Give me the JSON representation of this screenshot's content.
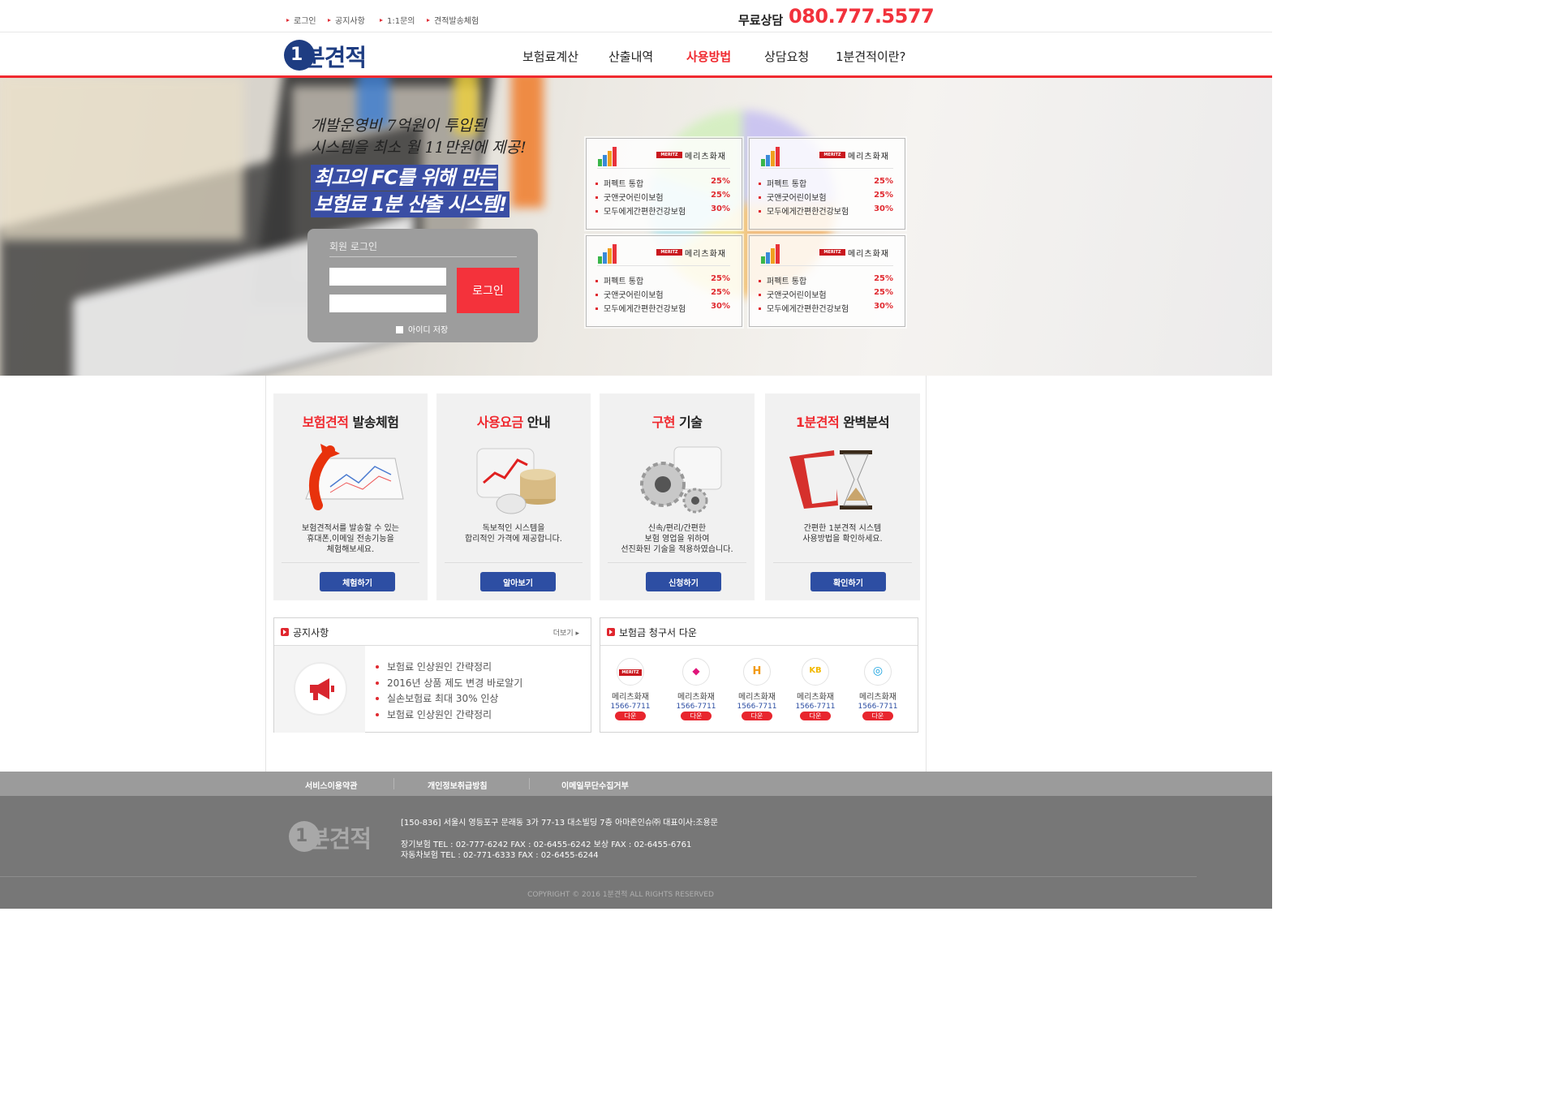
{
  "utility_nav": [
    "로그인",
    "공지사항",
    "1:1문의",
    "견적발송체험"
  ],
  "consult": {
    "label": "무료상담",
    "number": "080.777.5577"
  },
  "logo": {
    "one": "1",
    "rest": "분견적"
  },
  "gnb": [
    {
      "label": "보험료계산",
      "active": false
    },
    {
      "label": "산출내역",
      "active": false
    },
    {
      "label": "사용방법",
      "active": true
    },
    {
      "label": "상담요청",
      "active": false
    },
    {
      "label": "1분견적이란?",
      "active": false
    }
  ],
  "hero": {
    "copy_line1": "개발운영비 7억원이 투입된",
    "copy_line2": "시스템을 최소 월 11만원에 제공!",
    "highlight1": "최고의 FC를 위해 만든",
    "highlight2": "보험료 1분 산출 시스템!"
  },
  "login": {
    "title": "회원 로그인",
    "button": "로그인",
    "save_id": "아이디 저장"
  },
  "rate_cards": [
    {
      "brand_logo": "MERITZ",
      "company": "메리츠화재",
      "rows": [
        {
          "name": "퍼펙트 통합",
          "rate": "25%"
        },
        {
          "name": "굿앤굿어린이보험",
          "rate": "25%"
        },
        {
          "name": "모두에게간편한건강보험",
          "rate": "30%"
        }
      ]
    },
    {
      "brand_logo": "MERITZ",
      "company": "메리츠화재",
      "rows": [
        {
          "name": "퍼펙트 통합",
          "rate": "25%"
        },
        {
          "name": "굿앤굿어린이보험",
          "rate": "25%"
        },
        {
          "name": "모두에게간편한건강보험",
          "rate": "30%"
        }
      ]
    },
    {
      "brand_logo": "MERITZ",
      "company": "메리츠화재",
      "rows": [
        {
          "name": "퍼펙트 통합",
          "rate": "25%"
        },
        {
          "name": "굿앤굿어린이보험",
          "rate": "25%"
        },
        {
          "name": "모두에게간편한건강보험",
          "rate": "30%"
        }
      ]
    },
    {
      "brand_logo": "MERITZ",
      "company": "메리츠화재",
      "rows": [
        {
          "name": "퍼펙트 통합",
          "rate": "25%"
        },
        {
          "name": "굿앤굿어린이보험",
          "rate": "25%"
        },
        {
          "name": "모두에게간편한건강보험",
          "rate": "30%"
        }
      ]
    }
  ],
  "features": [
    {
      "title_red": "보험견적",
      "title_black": " 발송체험",
      "desc": [
        "보험견적서를 발송할 수 있는",
        "휴대폰,이메일 전송기능을",
        "체험해보세요."
      ],
      "button": "체험하기",
      "image": "arrow-chart-icon"
    },
    {
      "title_red": "사용요금",
      "title_black": " 안내",
      "desc": [
        "독보적인 시스템을",
        "합리적인 가격에 제공합니다."
      ],
      "button": "알아보기",
      "image": "coins-chart-icon"
    },
    {
      "title_red": "구현",
      "title_black": " 기술",
      "desc": [
        "신속/편리/간편한",
        "보험 영업을 위하여",
        "선진화된 기술을 적용하였습니다."
      ],
      "button": "신청하기",
      "image": "gears-icon"
    },
    {
      "title_red": "1분견적",
      "title_black": " 완벽분석",
      "desc": [
        "간편한 1분견적 시스템",
        "사용방법을 확인하세요."
      ],
      "button": "확인하기",
      "image": "hourglass-icon"
    }
  ],
  "notice": {
    "title": "공지사항",
    "more": "더보기 ▸",
    "items": [
      "보험료 인상원인 간략정리",
      "2016년 상품 제도 변경 바로알기",
      "실손보험료 최대 30% 인상",
      "보험료 인상원인 간략정리"
    ]
  },
  "claims": {
    "title": "보험금 청구서 다운",
    "items": [
      {
        "logo": "MERITZ",
        "name": "메리츠화재",
        "phone": "1566-7711",
        "button": "다운"
      },
      {
        "logo": "◆",
        "name": "메리츠화재",
        "phone": "1566-7711",
        "button": "다운"
      },
      {
        "logo": "H",
        "name": "메리츠화재",
        "phone": "1566-7711",
        "button": "다운"
      },
      {
        "logo": "KB",
        "name": "메리츠화재",
        "phone": "1566-7711",
        "button": "다운"
      },
      {
        "logo": "◎",
        "name": "메리츠화재",
        "phone": "1566-7711",
        "button": "다운"
      }
    ]
  },
  "footer_nav": [
    "서비스이용약관",
    "개인정보취급방침",
    "이메일무단수집거부"
  ],
  "footer": {
    "address": "[150-836] 서울시 영등포구 문래동 3가 77-13 대소빌딩 7층 아마존인슈㈜ 대표이사:조용문",
    "line2": "장기보험 TEL : 02-777-6242 FAX : 02-6455-6242 보상 FAX : 02-6455-6761",
    "line3": "자동차보험 TEL : 02-771-6333 FAX : 02-6455-6244",
    "copyright": "COPYRIGHT © 2016 1분견적 ALL RIGHTS RESERVED"
  },
  "colors": {
    "accent_red": "#f02a30",
    "brand_navy": "#1e3d82",
    "button_blue": "#2d4ea3"
  }
}
